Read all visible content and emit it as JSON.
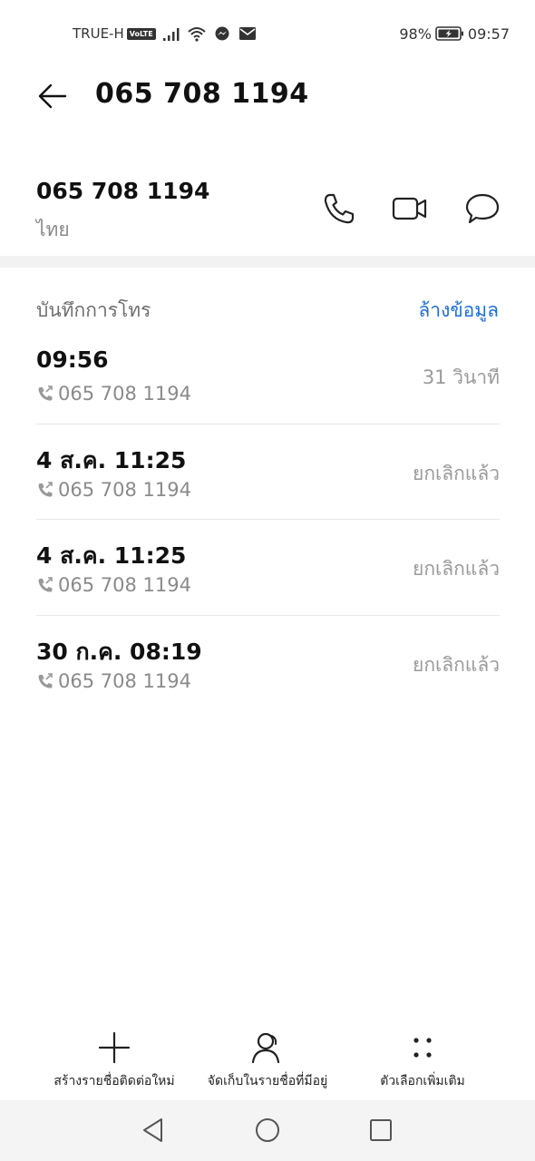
{
  "status_bar": {
    "carrier": "TRUE-H",
    "volte": "VoLTE",
    "battery": "98%",
    "time": "09:57",
    "icons": [
      "signal-icon",
      "wifi-icon",
      "messenger-icon",
      "mail-icon",
      "battery-charging-icon"
    ]
  },
  "header": {
    "title": "065 708 1194",
    "back_icon": "back-arrow-icon"
  },
  "contact": {
    "number": "065 708 1194",
    "location": "ไทย",
    "actions": [
      "phone-icon",
      "video-call-icon",
      "message-icon"
    ]
  },
  "call_log": {
    "title": "บันทึกการโทร",
    "clear_label": "ล้างข้อมูล",
    "entries": [
      {
        "time": "09:56",
        "number": "065 708 1194",
        "status": "31 วินาที"
      },
      {
        "time": "4 ส.ค. 11:25",
        "number": "065 708 1194",
        "status": "ยกเลิกแล้ว"
      },
      {
        "time": "4 ส.ค. 11:25",
        "number": "065 708 1194",
        "status": "ยกเลิกแล้ว"
      },
      {
        "time": "30 ก.ค. 08:19",
        "number": "065 708 1194",
        "status": "ยกเลิกแล้ว"
      }
    ]
  },
  "bottom_actions": {
    "new_contact": "สร้างรายชื่อติดต่อใหม่",
    "save_existing": "จัดเก็บในรายชื่อที่มีอยู่",
    "more_options": "ตัวเลือกเพิ่มเติม"
  },
  "colors": {
    "accent": "#1e6fd9",
    "text_primary": "#111111",
    "text_secondary": "#8a8a8a",
    "divider": "#e6e6e6",
    "nav_bar": "#f4f4f4"
  }
}
